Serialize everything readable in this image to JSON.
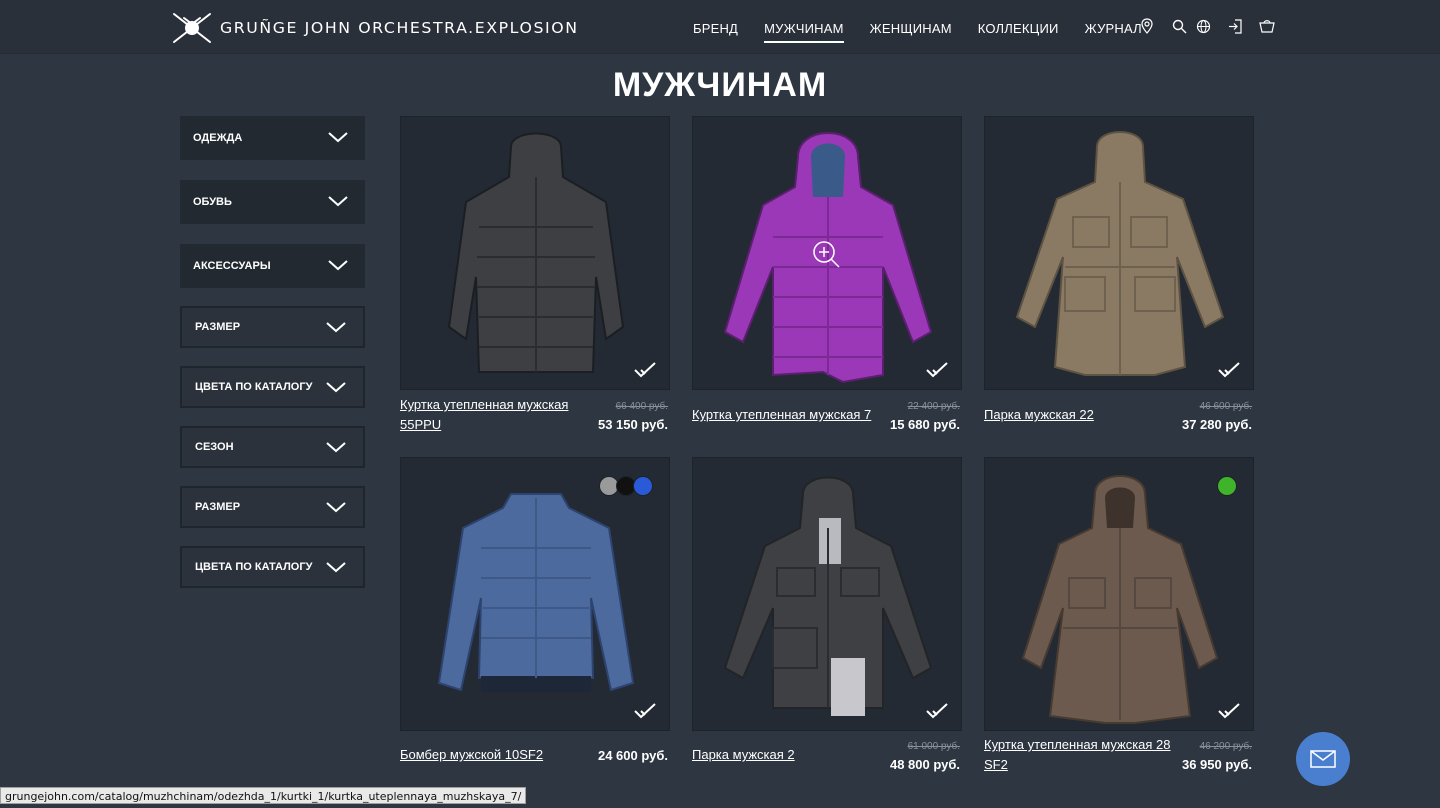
{
  "brand": {
    "name": "GRUÑGE JOHN ORCHESTRA.EXPLOSION"
  },
  "nav": {
    "items": [
      "БРЕНД",
      "МУЖЧИНАМ",
      "ЖЕНЩИНАМ",
      "КОЛЛЕКЦИИ",
      "ЖУРНАЛ"
    ],
    "active": "МУЖЧИНАМ",
    "icons": [
      "location-pin-icon",
      "search-icon",
      "globe-icon",
      "login-icon",
      "cart-icon"
    ]
  },
  "page": {
    "title": "МУЖЧИНАМ"
  },
  "filters": [
    {
      "label": "ОДЕЖДА"
    },
    {
      "label": "ОБУВЬ"
    },
    {
      "label": "АКСЕССУАРЫ"
    },
    {
      "label": "РАЗМЕР"
    },
    {
      "label": "ЦВЕТА ПО КАТАЛОГУ"
    },
    {
      "label": "СЕЗОН"
    },
    {
      "label": "РАЗМЕР"
    },
    {
      "label": "ЦВЕТА ПО КАТАЛОГУ"
    }
  ],
  "products": [
    {
      "name": "Куртка утепленная мужская 55PPU",
      "old_price": "66 400 руб.",
      "price": "53 150 руб.",
      "color": "#3d3f43"
    },
    {
      "name": "Куртка утепленная мужская 7",
      "old_price": "22 400 руб.",
      "price": "15 680 руб.",
      "color": "#9b38b8"
    },
    {
      "name": "Парка мужская 22",
      "old_price": "46 600 руб.",
      "price": "37 280 руб.",
      "color": "#8a7a63"
    },
    {
      "name": "Бомбер мужской 10SF2",
      "old_price": "",
      "price": "24 600 руб.",
      "color": "#4c6a9e",
      "swatches": [
        "#9a9a9a",
        "#111111",
        "#2a5ad8"
      ]
    },
    {
      "name": "Парка мужская 2",
      "old_price": "61 000 руб.",
      "price": "48 800 руб.",
      "color": "#3e4044"
    },
    {
      "name": "Куртка утепленная мужская 28 SF2",
      "old_price": "46 200 руб.",
      "price": "36 950 руб.",
      "color": "#6b5a4d",
      "swatches": [
        "#3fb42b"
      ]
    }
  ],
  "status_bar": {
    "url": "grungejohn.com/catalog/muzhchinam/odezhda_1/kurtki_1/kurtka_uteplennaya_muzhskaya_7/"
  },
  "colors": {
    "background": "#2e3641",
    "card": "#232a33",
    "accent": "#4a7fd0"
  }
}
